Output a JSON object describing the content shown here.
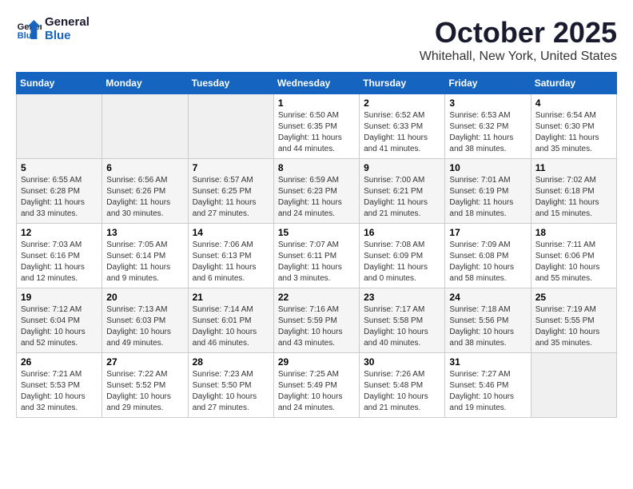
{
  "header": {
    "logo_line1": "General",
    "logo_line2": "Blue",
    "month": "October 2025",
    "location": "Whitehall, New York, United States"
  },
  "weekdays": [
    "Sunday",
    "Monday",
    "Tuesday",
    "Wednesday",
    "Thursday",
    "Friday",
    "Saturday"
  ],
  "weeks": [
    [
      {
        "day": "",
        "info": ""
      },
      {
        "day": "",
        "info": ""
      },
      {
        "day": "",
        "info": ""
      },
      {
        "day": "1",
        "info": "Sunrise: 6:50 AM\nSunset: 6:35 PM\nDaylight: 11 hours\nand 44 minutes."
      },
      {
        "day": "2",
        "info": "Sunrise: 6:52 AM\nSunset: 6:33 PM\nDaylight: 11 hours\nand 41 minutes."
      },
      {
        "day": "3",
        "info": "Sunrise: 6:53 AM\nSunset: 6:32 PM\nDaylight: 11 hours\nand 38 minutes."
      },
      {
        "day": "4",
        "info": "Sunrise: 6:54 AM\nSunset: 6:30 PM\nDaylight: 11 hours\nand 35 minutes."
      }
    ],
    [
      {
        "day": "5",
        "info": "Sunrise: 6:55 AM\nSunset: 6:28 PM\nDaylight: 11 hours\nand 33 minutes."
      },
      {
        "day": "6",
        "info": "Sunrise: 6:56 AM\nSunset: 6:26 PM\nDaylight: 11 hours\nand 30 minutes."
      },
      {
        "day": "7",
        "info": "Sunrise: 6:57 AM\nSunset: 6:25 PM\nDaylight: 11 hours\nand 27 minutes."
      },
      {
        "day": "8",
        "info": "Sunrise: 6:59 AM\nSunset: 6:23 PM\nDaylight: 11 hours\nand 24 minutes."
      },
      {
        "day": "9",
        "info": "Sunrise: 7:00 AM\nSunset: 6:21 PM\nDaylight: 11 hours\nand 21 minutes."
      },
      {
        "day": "10",
        "info": "Sunrise: 7:01 AM\nSunset: 6:19 PM\nDaylight: 11 hours\nand 18 minutes."
      },
      {
        "day": "11",
        "info": "Sunrise: 7:02 AM\nSunset: 6:18 PM\nDaylight: 11 hours\nand 15 minutes."
      }
    ],
    [
      {
        "day": "12",
        "info": "Sunrise: 7:03 AM\nSunset: 6:16 PM\nDaylight: 11 hours\nand 12 minutes."
      },
      {
        "day": "13",
        "info": "Sunrise: 7:05 AM\nSunset: 6:14 PM\nDaylight: 11 hours\nand 9 minutes."
      },
      {
        "day": "14",
        "info": "Sunrise: 7:06 AM\nSunset: 6:13 PM\nDaylight: 11 hours\nand 6 minutes."
      },
      {
        "day": "15",
        "info": "Sunrise: 7:07 AM\nSunset: 6:11 PM\nDaylight: 11 hours\nand 3 minutes."
      },
      {
        "day": "16",
        "info": "Sunrise: 7:08 AM\nSunset: 6:09 PM\nDaylight: 11 hours\nand 0 minutes."
      },
      {
        "day": "17",
        "info": "Sunrise: 7:09 AM\nSunset: 6:08 PM\nDaylight: 10 hours\nand 58 minutes."
      },
      {
        "day": "18",
        "info": "Sunrise: 7:11 AM\nSunset: 6:06 PM\nDaylight: 10 hours\nand 55 minutes."
      }
    ],
    [
      {
        "day": "19",
        "info": "Sunrise: 7:12 AM\nSunset: 6:04 PM\nDaylight: 10 hours\nand 52 minutes."
      },
      {
        "day": "20",
        "info": "Sunrise: 7:13 AM\nSunset: 6:03 PM\nDaylight: 10 hours\nand 49 minutes."
      },
      {
        "day": "21",
        "info": "Sunrise: 7:14 AM\nSunset: 6:01 PM\nDaylight: 10 hours\nand 46 minutes."
      },
      {
        "day": "22",
        "info": "Sunrise: 7:16 AM\nSunset: 5:59 PM\nDaylight: 10 hours\nand 43 minutes."
      },
      {
        "day": "23",
        "info": "Sunrise: 7:17 AM\nSunset: 5:58 PM\nDaylight: 10 hours\nand 40 minutes."
      },
      {
        "day": "24",
        "info": "Sunrise: 7:18 AM\nSunset: 5:56 PM\nDaylight: 10 hours\nand 38 minutes."
      },
      {
        "day": "25",
        "info": "Sunrise: 7:19 AM\nSunset: 5:55 PM\nDaylight: 10 hours\nand 35 minutes."
      }
    ],
    [
      {
        "day": "26",
        "info": "Sunrise: 7:21 AM\nSunset: 5:53 PM\nDaylight: 10 hours\nand 32 minutes."
      },
      {
        "day": "27",
        "info": "Sunrise: 7:22 AM\nSunset: 5:52 PM\nDaylight: 10 hours\nand 29 minutes."
      },
      {
        "day": "28",
        "info": "Sunrise: 7:23 AM\nSunset: 5:50 PM\nDaylight: 10 hours\nand 27 minutes."
      },
      {
        "day": "29",
        "info": "Sunrise: 7:25 AM\nSunset: 5:49 PM\nDaylight: 10 hours\nand 24 minutes."
      },
      {
        "day": "30",
        "info": "Sunrise: 7:26 AM\nSunset: 5:48 PM\nDaylight: 10 hours\nand 21 minutes."
      },
      {
        "day": "31",
        "info": "Sunrise: 7:27 AM\nSunset: 5:46 PM\nDaylight: 10 hours\nand 19 minutes."
      },
      {
        "day": "",
        "info": ""
      }
    ]
  ]
}
